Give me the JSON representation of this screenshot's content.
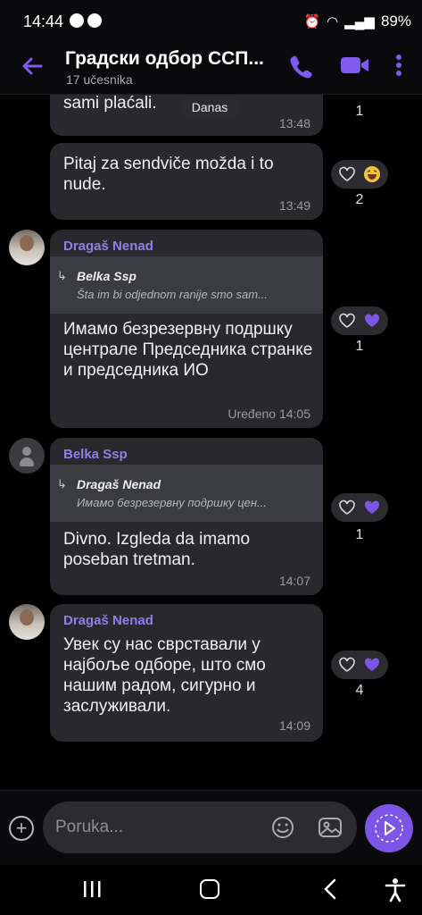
{
  "status_bar": {
    "time": "14:44",
    "battery": "89%"
  },
  "header": {
    "title": "Градски одбор ССП...",
    "subtitle": "17 učesnika"
  },
  "date_separator": "Danas",
  "messages": [
    {
      "sender": "",
      "text": "sami plaćali.",
      "time": "13:48",
      "reaction_count": "1"
    },
    {
      "sender": "",
      "text": "Pitaj za sendviče možda i to nude.",
      "time": "13:49",
      "reaction_count": "2"
    },
    {
      "sender": "Dragaš Nenad",
      "quote_name": "Belka Ssp",
      "quote_text": "Šta im bi odjednom ranije smo sam...",
      "text": "Имамо безрезервну подршку централе Председника странке и председника ИО",
      "time": "14:05",
      "edited": "Uređeno",
      "reaction_count": "1"
    },
    {
      "sender": "Belka Ssp",
      "quote_name": "Dragaš Nenad",
      "quote_text": "Имамо безрезервну подршку цен...",
      "text": "Divno. Izgleda da imamo poseban tretman.",
      "time": "14:07",
      "reaction_count": "1"
    },
    {
      "sender": "Dragaš Nenad",
      "text": "Увек су нас сврставали у најбоље одборе, што смо нашим радом, сигурно и заслуживали.",
      "time": "14:09",
      "reaction_count": "4"
    }
  ],
  "composer": {
    "placeholder": "Poruka..."
  },
  "colors": {
    "accent": "#7b55e6",
    "bubble": "#28282d",
    "sender_name": "#8e80e8"
  },
  "icons": [
    "back-arrow-icon",
    "phone-icon",
    "video-icon",
    "more-icon",
    "heart-icon",
    "laugh-emoji-icon",
    "plus-icon",
    "emoji-icon",
    "gallery-icon",
    "send-icon"
  ]
}
